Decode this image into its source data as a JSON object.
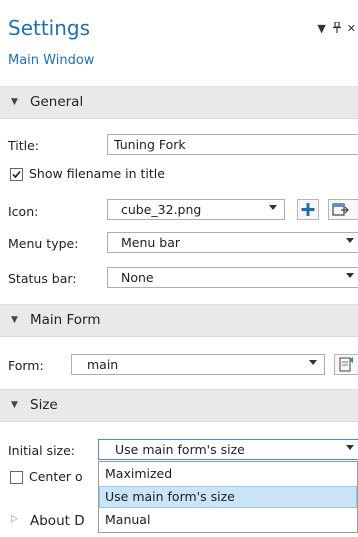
{
  "header": {
    "title": "Settings",
    "subtitle": "Main Window"
  },
  "sections": {
    "general": "General",
    "main_form": "Main Form",
    "size": "Size",
    "about": "About D"
  },
  "general": {
    "title_label": "Title:",
    "title_value": "Tuning Fork",
    "show_filename_label": "Show filename in title",
    "show_filename_checked": true,
    "icon_label": "Icon:",
    "icon_value": "cube_32.png",
    "menu_type_label": "Menu type:",
    "menu_type_value": "Menu bar",
    "status_bar_label": "Status bar:",
    "status_bar_value": "None"
  },
  "main_form": {
    "form_label": "Form:",
    "form_value": "main"
  },
  "size": {
    "initial_size_label": "Initial size:",
    "initial_size_value": "Use main form's size",
    "center_label": "Center o",
    "center_checked": false,
    "options": [
      "Maximized",
      "Use main form's size",
      "Manual"
    ],
    "selected_option": "Use main form's size"
  },
  "colors": {
    "accent": "#1f6fb5",
    "section_bg": "#e9e9ea",
    "selected_bg": "#cce4f7",
    "field_focus_border": "#4a90d9"
  }
}
